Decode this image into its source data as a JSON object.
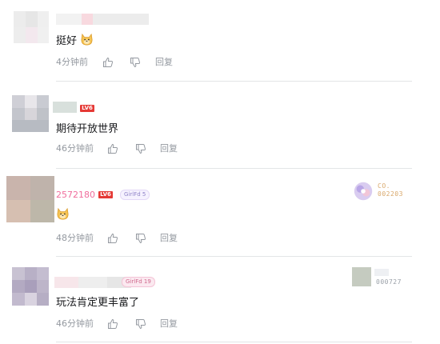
{
  "colors": {
    "level_badge": "#e53935",
    "uid_pink": "#f06d9c",
    "meta_grey": "#9499a0",
    "divider": "#e3e5e7"
  },
  "icons": {
    "like": "thumbs-up-outline",
    "dislike": "thumbs-down-outline",
    "emoji": "doge-face"
  },
  "comments": [
    {
      "username": "",
      "content": "挺好",
      "has_emoji": true,
      "time": "4分钟前",
      "reply_label": "回复"
    },
    {
      "username": "",
      "level": "LV6",
      "content": "期待开放世界",
      "time": "46分钟前",
      "reply_label": "回复"
    },
    {
      "username": "2572180",
      "level": "LV6",
      "fan_medal": "GirlFd 5",
      "content": "",
      "has_emoji": true,
      "decoration": {
        "line1": "CO.",
        "line2": "002203"
      },
      "time": "48分钟前",
      "reply_label": "回复"
    },
    {
      "username": "",
      "fan_medal": "GirlFd 19",
      "content": "玩法肯定更丰富了",
      "decoration": {
        "line2": "000727"
      },
      "time": "46分钟前",
      "reply_label": "回复"
    }
  ]
}
